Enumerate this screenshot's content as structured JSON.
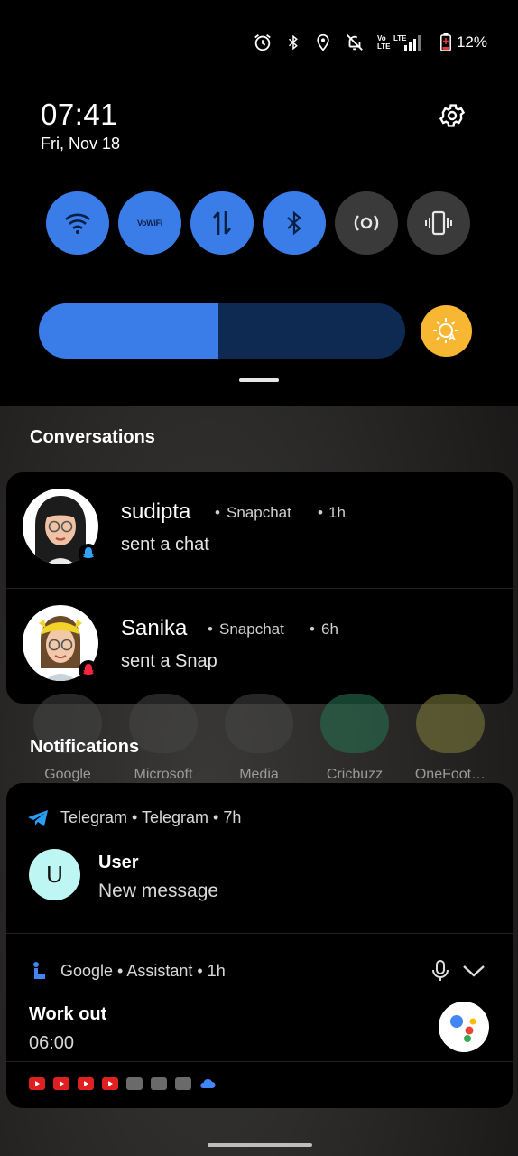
{
  "status_bar": {
    "battery": "12%",
    "icons": [
      "alarm-icon",
      "bluetooth-icon",
      "location-icon",
      "dnd-off-icon",
      "volte-icon",
      "lte-signal-icon",
      "battery-icon"
    ]
  },
  "quick_settings": {
    "time": "07:41",
    "date": "Fri, Nov 18",
    "tiles": [
      {
        "name": "wifi",
        "state": "on"
      },
      {
        "name": "vowifi",
        "label": "VoWiFi",
        "state": "on"
      },
      {
        "name": "mobile-data",
        "state": "on"
      },
      {
        "name": "bluetooth",
        "state": "on"
      },
      {
        "name": "hotspot",
        "state": "off"
      },
      {
        "name": "vibrate",
        "state": "off"
      }
    ],
    "brightness_fraction": 0.49,
    "accent_color": "#3a7de9",
    "auto_brightness_color": "#f7b733"
  },
  "conversations": {
    "title": "Conversations",
    "items": [
      {
        "name": "sudipta",
        "app": "Snapchat",
        "time": "1h",
        "message": "sent a chat",
        "badge_color": "#2fa3f5"
      },
      {
        "name": "Sanika",
        "app": "Snapchat",
        "time": "6h",
        "message": "sent a Snap",
        "badge_color": "#f2263f"
      }
    ]
  },
  "home_folders": [
    "Google",
    "Microsoft",
    "Media",
    "Cricbuzz",
    "OneFoot…"
  ],
  "notifications": {
    "title": "Notifications",
    "telegram": {
      "header": "Telegram • Telegram • 7h",
      "avatar_letter": "U",
      "title": "User",
      "text": "New message"
    },
    "google": {
      "header": "Google • Assistant • 1h",
      "title": "Work out",
      "text": "06:00"
    }
  }
}
